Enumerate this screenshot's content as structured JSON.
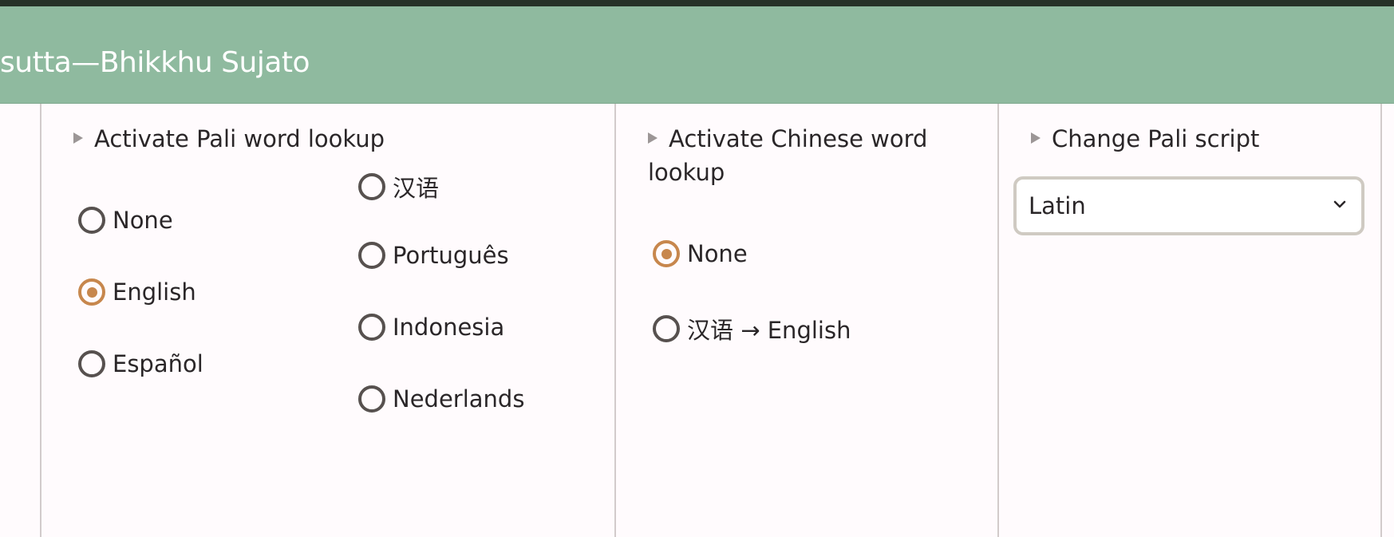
{
  "header": {
    "title": "sutta—Bhikkhu Sujato"
  },
  "pali_lookup": {
    "title": "Activate Pali word lookup",
    "options": [
      "None",
      "English",
      "Español",
      "汉语",
      "Português",
      "Indonesia",
      "Nederlands"
    ],
    "selected": "English"
  },
  "chinese_lookup": {
    "title_line1": "Activate Chinese word",
    "title_line2": "lookup",
    "options": [
      "None",
      "汉语 → English"
    ],
    "selected": "None"
  },
  "pali_script": {
    "title": "Change Pali script",
    "selected_value": "Latin"
  },
  "colors": {
    "header_bg": "#8fba9f",
    "accent": "#c7874d",
    "top_bar": "#263228"
  },
  "icons": {
    "disclosure": "triangle-right-icon",
    "dropdown": "chevron-down-icon"
  }
}
